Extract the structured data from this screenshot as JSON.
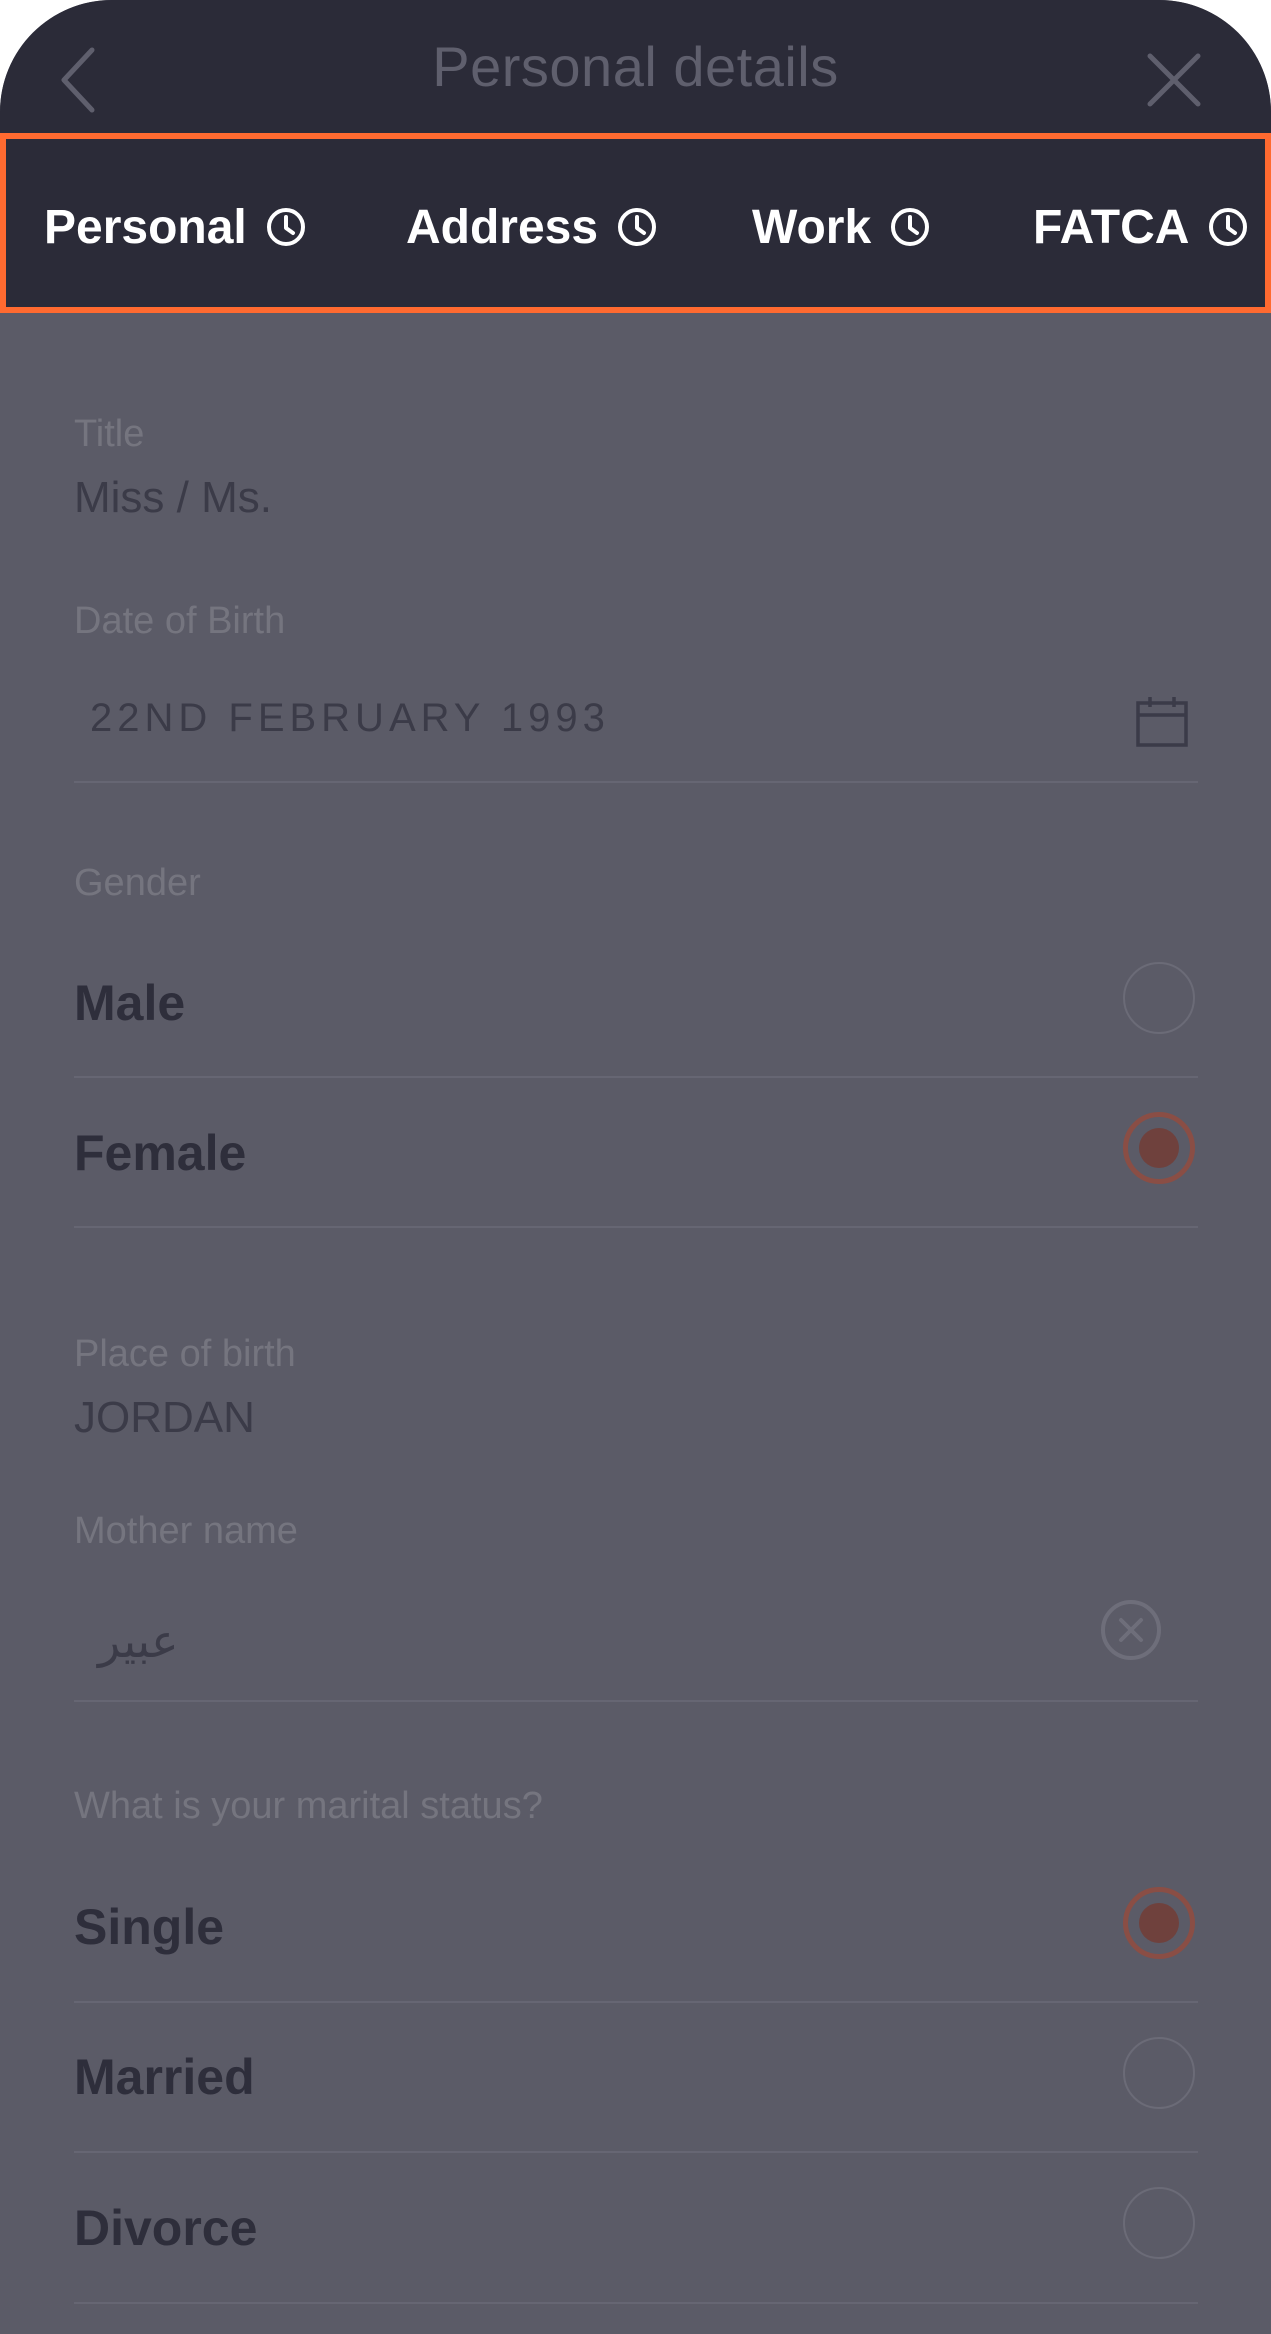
{
  "header": {
    "title": "Personal details"
  },
  "tabs": [
    {
      "label": "Personal"
    },
    {
      "label": "Address"
    },
    {
      "label": "Work"
    },
    {
      "label": "FATCA"
    }
  ],
  "form": {
    "title": {
      "label": "Title",
      "value": "Miss / Ms."
    },
    "dob": {
      "label": "Date of Birth",
      "value": "22ND FEBRUARY 1993"
    },
    "gender": {
      "label": "Gender",
      "options": [
        {
          "label": "Male",
          "selected": false
        },
        {
          "label": "Female",
          "selected": true
        }
      ]
    },
    "place_of_birth": {
      "label": "Place of birth",
      "value": "JORDAN"
    },
    "mother_name": {
      "label": "Mother name",
      "value": "عبير"
    },
    "marital_status": {
      "label": "What is your marital status?",
      "options": [
        {
          "label": "Single",
          "selected": true
        },
        {
          "label": "Married",
          "selected": false
        },
        {
          "label": "Divorce",
          "selected": false
        }
      ]
    }
  },
  "colors": {
    "highlight": "#ff6a30",
    "header_bg": "#2b2b38",
    "overlay_bg": "#5b5b67"
  },
  "icons": [
    "back-chevron-icon",
    "close-icon",
    "clock-icon",
    "calendar-icon",
    "clear-circle-icon",
    "radio-icon"
  ]
}
